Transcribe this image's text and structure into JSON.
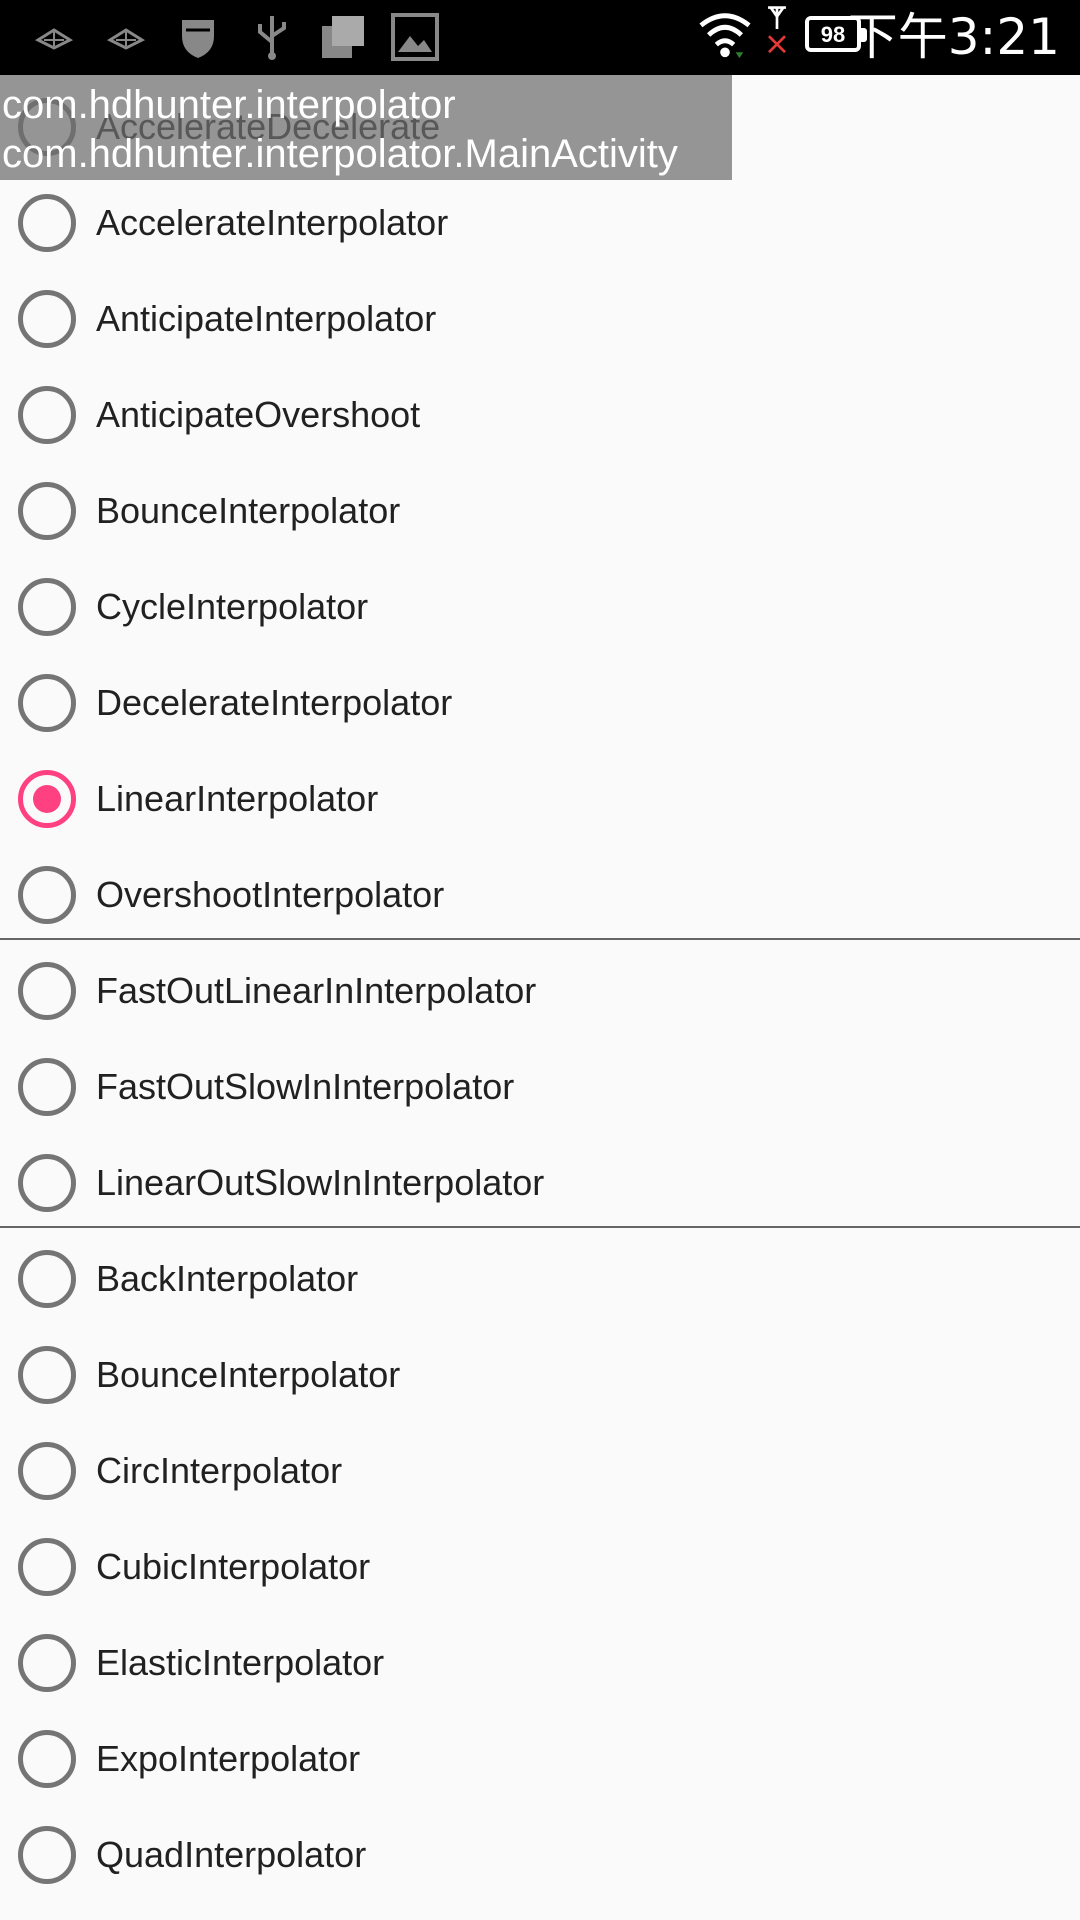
{
  "status_bar": {
    "time": "下午3:21",
    "battery_level": "98",
    "icons": [
      "app-icon-1",
      "app-icon-2",
      "shield-icon",
      "usb-icon",
      "stack-icon",
      "image-icon",
      "wifi-icon",
      "no-signal-icon",
      "battery-icon"
    ]
  },
  "overlay": {
    "package_name": "com.hdhunter.interpolator",
    "activity_name": "com.hdhunter.interpolator.MainActivity"
  },
  "colors": {
    "accent": "#ff4081",
    "radio_unchecked": "#757575",
    "background": "#fafafa"
  },
  "groups": [
    {
      "items": [
        {
          "label": "AccelerateDecelerate",
          "checked": false
        },
        {
          "label": "AccelerateInterpolator",
          "checked": false
        },
        {
          "label": "AnticipateInterpolator",
          "checked": false
        },
        {
          "label": "AnticipateOvershoot",
          "checked": false
        },
        {
          "label": "BounceInterpolator",
          "checked": false
        },
        {
          "label": "CycleInterpolator",
          "checked": false
        },
        {
          "label": "DecelerateInterpolator",
          "checked": false
        },
        {
          "label": "LinearInterpolator",
          "checked": true
        },
        {
          "label": "OvershootInterpolator",
          "checked": false
        }
      ]
    },
    {
      "items": [
        {
          "label": "FastOutLinearInInterpolator",
          "checked": false
        },
        {
          "label": "FastOutSlowInInterpolator",
          "checked": false
        },
        {
          "label": "LinearOutSlowInInterpolator",
          "checked": false
        }
      ]
    },
    {
      "items": [
        {
          "label": "BackInterpolator",
          "checked": false
        },
        {
          "label": "BounceInterpolator",
          "checked": false
        },
        {
          "label": "CircInterpolator",
          "checked": false
        },
        {
          "label": "CubicInterpolator",
          "checked": false
        },
        {
          "label": "ElasticInterpolator",
          "checked": false
        },
        {
          "label": "ExpoInterpolator",
          "checked": false
        },
        {
          "label": "QuadInterpolator",
          "checked": false
        }
      ]
    }
  ]
}
